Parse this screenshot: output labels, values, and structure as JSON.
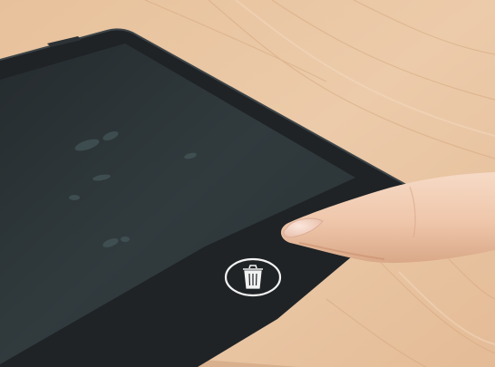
{
  "photo": {
    "subject": "lcd-writing-tablet",
    "colors": {
      "table": "#e7c4a2",
      "table_grain": "#d7ab84",
      "tablet_body": "#1f2326",
      "screen": "#2f383b",
      "screen_marks": "#4c6063",
      "button_outline": "#f2f2f2",
      "finger_skin": "#f0c9ad"
    },
    "icons": {
      "erase_button": "trash-can-icon",
      "camera_hole": "hole-icon"
    }
  }
}
